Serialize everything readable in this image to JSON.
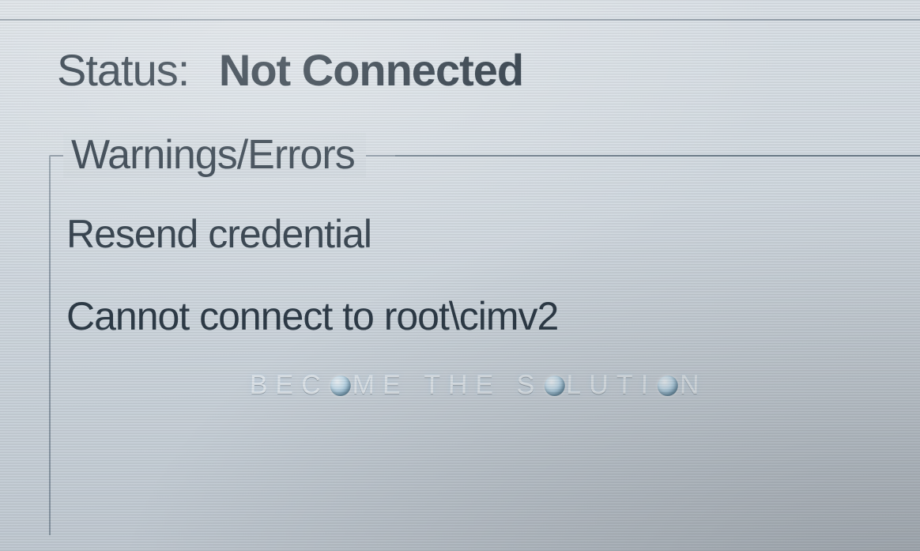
{
  "status": {
    "label": "Status:",
    "value": "Not Connected"
  },
  "group": {
    "title": "Warnings/Errors",
    "messages": [
      "Resend credential",
      "Cannot connect to root\\cimv2"
    ]
  },
  "watermark": {
    "text": "BECOME THE SOLUTION"
  }
}
